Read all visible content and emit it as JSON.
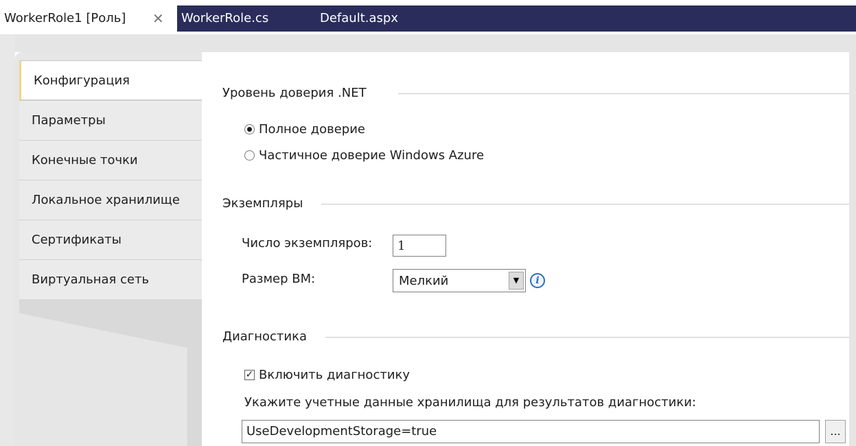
{
  "tabs": [
    {
      "label": "WorkerRole1 [Роль]",
      "close_glyph": "✕"
    },
    {
      "label": "WorkerRole.cs"
    },
    {
      "label": "Default.aspx"
    }
  ],
  "sidebar": {
    "items": [
      {
        "label": "Конфигурация"
      },
      {
        "label": "Параметры"
      },
      {
        "label": "Конечные точки"
      },
      {
        "label": "Локальное хранилище"
      },
      {
        "label": "Сертификаты"
      },
      {
        "label": "Виртуальная сеть"
      }
    ]
  },
  "trust": {
    "title": "Уровень доверия .NET",
    "options": [
      {
        "label": "Полное доверие",
        "selected": true
      },
      {
        "label": "Частичное доверие Windows Azure",
        "selected": false
      }
    ]
  },
  "instances": {
    "title": "Экземпляры",
    "count_label": "Число экземпляров:",
    "count_value": "1",
    "vm_size_label": "Размер ВМ:",
    "vm_size_value": "Мелкий",
    "dropdown_glyph": "▼",
    "info_glyph": "i"
  },
  "diagnostics": {
    "title": "Диагностика",
    "enable_label": "Включить диагностику",
    "enable_checked": true,
    "check_glyph": "✓",
    "storage_label": "Укажите учетные данные хранилища для результатов диагностики:",
    "storage_value": "UseDevelopmentStorage=true",
    "browse_label": "..."
  }
}
